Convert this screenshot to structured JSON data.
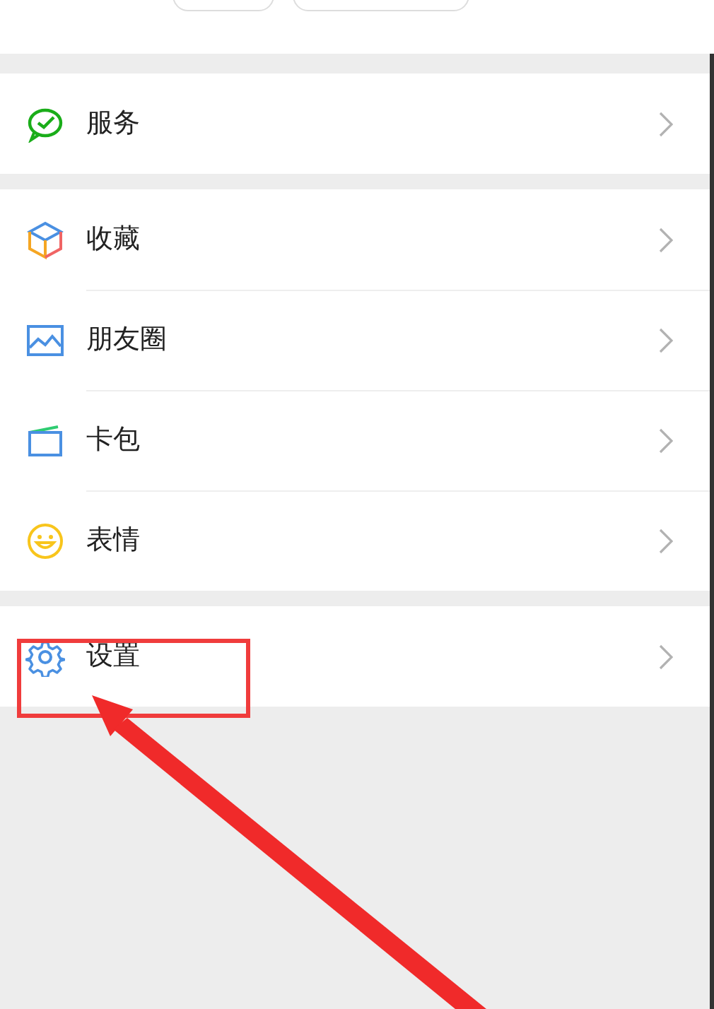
{
  "sections": [
    {
      "items": [
        {
          "label": "服务",
          "highlighted": false
        }
      ]
    },
    {
      "items": [
        {
          "label": "收藏",
          "highlighted": false
        },
        {
          "label": "朋友圈",
          "highlighted": false
        },
        {
          "label": "卡包",
          "highlighted": false
        },
        {
          "label": "表情",
          "highlighted": false
        }
      ]
    },
    {
      "items": [
        {
          "label": "设置",
          "highlighted": true
        }
      ]
    }
  ]
}
